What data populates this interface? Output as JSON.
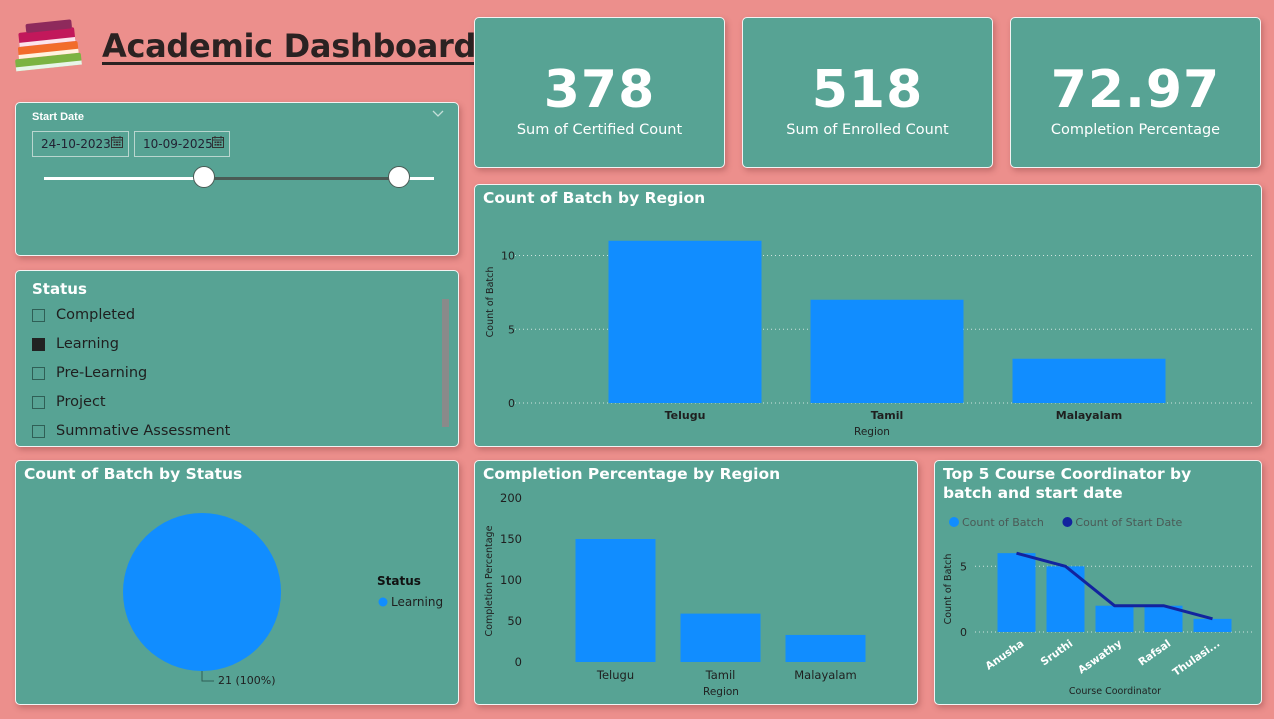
{
  "header": {
    "title": "Academic Dashboard",
    "logo_icon": "books-stack-icon"
  },
  "kpis": [
    {
      "value": "378",
      "label": "Sum of Certified Count"
    },
    {
      "value": "518",
      "label": "Sum of Enrolled Count"
    },
    {
      "value": "72.97",
      "label": "Completion Percentage"
    }
  ],
  "date_slicer": {
    "title": "Start Date",
    "start": "24-10-2023",
    "end": "10-09-2025",
    "start_position": 0.41,
    "end_position": 0.91
  },
  "status_slicer": {
    "title": "Status",
    "items": [
      {
        "label": "Completed",
        "checked": false
      },
      {
        "label": "Learning",
        "checked": true
      },
      {
        "label": "Pre-Learning",
        "checked": false
      },
      {
        "label": "Project",
        "checked": false
      },
      {
        "label": "Summative Assessment",
        "checked": false
      }
    ]
  },
  "colors": {
    "bar": "#118dff",
    "line": "#12239e",
    "card": "#57a394",
    "background": "#ec8f8c"
  },
  "chart_data": [
    {
      "id": "batch-by-region",
      "type": "bar",
      "title": "Count of Batch by Region",
      "categories": [
        "Telugu",
        "Tamil",
        "Malayalam"
      ],
      "values": [
        11,
        7,
        3
      ],
      "xlabel": "Region",
      "ylabel": "Count of Batch",
      "yticks": [
        0,
        5,
        10
      ],
      "ylim": [
        0,
        12
      ],
      "grid": true
    },
    {
      "id": "batch-by-status",
      "type": "pie",
      "title": "Count of Batch by Status",
      "categories": [
        "Learning"
      ],
      "values": [
        21
      ],
      "data_labels": [
        "21 (100%)"
      ],
      "legend_title": "Status",
      "legend": [
        "Learning"
      ],
      "legend_position": "right"
    },
    {
      "id": "completion-by-region",
      "type": "bar",
      "title": "Completion Percentage by Region",
      "categories": [
        "Telugu",
        "Tamil",
        "Malayalam"
      ],
      "values": [
        150,
        59,
        33
      ],
      "xlabel": "Region",
      "ylabel": "Completion Percentage",
      "yticks": [
        0,
        50,
        100,
        150,
        200
      ],
      "ylim": [
        0,
        200
      ],
      "grid": false
    },
    {
      "id": "top5-coordinators",
      "type": "bar",
      "title": "Top 5 Course Coordinator by batch and start date",
      "categories": [
        "Anusha",
        "Sruthi",
        "Aswathy",
        "Rafsal",
        "Thulasi..."
      ],
      "series": [
        {
          "name": "Count of Batch",
          "type": "bar",
          "values": [
            6,
            5,
            2,
            2,
            1
          ]
        },
        {
          "name": "Count of Start Date",
          "type": "line",
          "values": [
            6,
            5,
            2,
            2,
            1
          ]
        }
      ],
      "xlabel": "Course Coordinator",
      "ylabel": "Count of Batch",
      "yticks": [
        0,
        5
      ],
      "ylim": [
        0,
        7
      ],
      "legend_position": "top-left",
      "grid": true
    }
  ]
}
